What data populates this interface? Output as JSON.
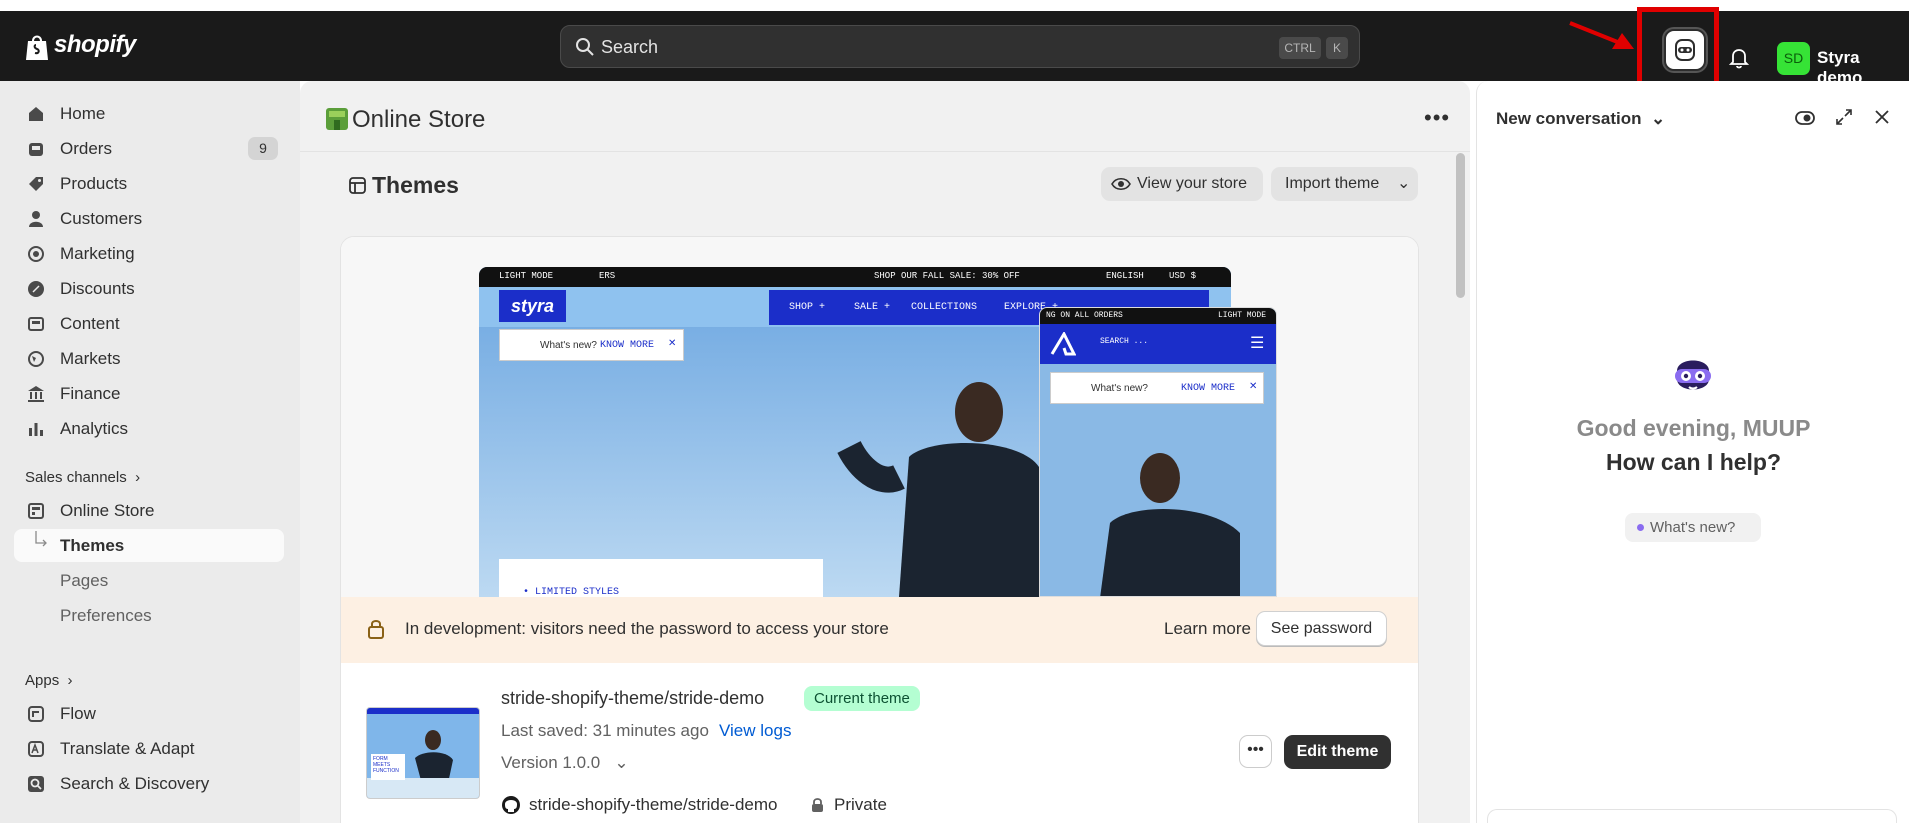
{
  "topbar": {
    "logo_text": "shopify",
    "search_placeholder": "Search",
    "kbd_ctrl": "CTRL",
    "kbd_k": "K",
    "avatar_initials": "SD",
    "user_name": "Styra demo"
  },
  "sidebar": {
    "items": [
      {
        "label": "Home"
      },
      {
        "label": "Orders",
        "badge": "9"
      },
      {
        "label": "Products"
      },
      {
        "label": "Customers"
      },
      {
        "label": "Marketing"
      },
      {
        "label": "Discounts"
      },
      {
        "label": "Content"
      },
      {
        "label": "Markets"
      },
      {
        "label": "Finance"
      },
      {
        "label": "Analytics"
      }
    ],
    "sales_channels_label": "Sales channels",
    "online_store": "Online Store",
    "sub_items": [
      "Themes",
      "Pages",
      "Preferences"
    ],
    "apps_label": "Apps",
    "apps": [
      "Flow",
      "Translate & Adapt",
      "Search & Discovery"
    ]
  },
  "main": {
    "title": "Online Store",
    "section_title": "Themes",
    "view_store": "View your store",
    "import_theme": "Import theme",
    "preview": {
      "light_mode": "LIGHT MODE",
      "ers": "ERS",
      "sale": "SHOP OUR FALL SALE: 30% OFF",
      "english": "ENGLISH",
      "usd": "USD $",
      "brand": "styra",
      "menu": [
        "SHOP +",
        "SALE +",
        "COLLECTIONS",
        "EXPLORE +"
      ],
      "whats_new": "What's new?",
      "know_more": "KNOW MORE",
      "limited": "• LIMITED STYLES",
      "mobile_bar": "NG ON ALL ORDERS",
      "mobile_search": "SEARCH ..."
    },
    "dev_notice": "In development: visitors need the password to access your store",
    "learn_more": "Learn more",
    "see_password": "See password",
    "theme": {
      "name": "stride-shopify-theme/stride-demo",
      "status": "Current theme",
      "last_saved": "Last saved: 31 minutes ago",
      "view_logs": "View logs",
      "version": "Version 1.0.0",
      "repo": "stride-shopify-theme/stride-demo",
      "visibility": "Private",
      "edit_button": "Edit theme",
      "thumb_text": "FORM MEETS FUNCTION"
    }
  },
  "panel": {
    "title": "New conversation",
    "greeting": "Good evening, MUUP",
    "question": "How can I help?",
    "chip": "What's new?"
  },
  "colors": {
    "topbar": "#1a1a1a",
    "highlight": "#e00000",
    "brand_blue": "#1b2ec9",
    "avatar_green": "#36e336",
    "current_theme_bg": "#b4fed2",
    "dev_notice_bg": "#fdf0e3"
  }
}
